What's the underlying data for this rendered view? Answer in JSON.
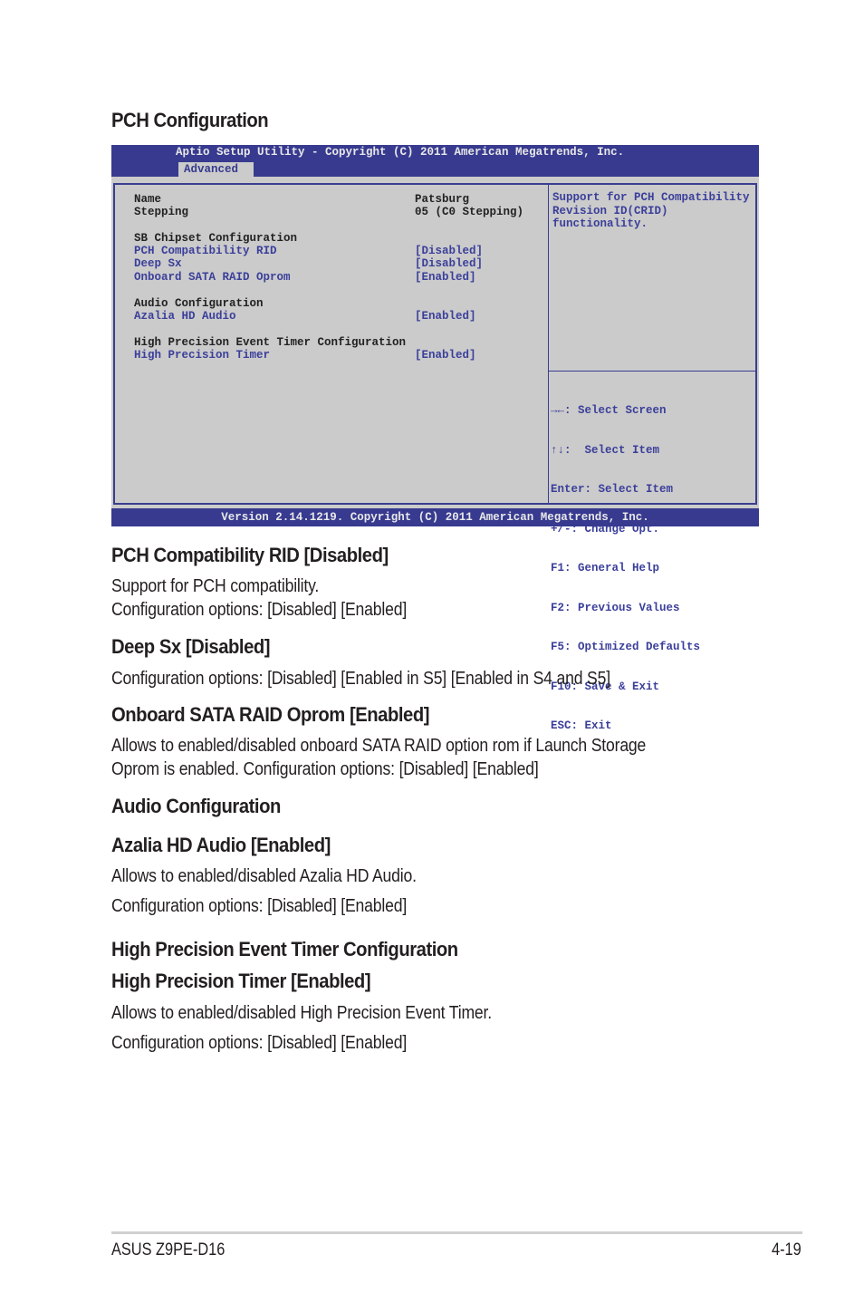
{
  "page_title": "PCH Configuration",
  "bios": {
    "title": "Aptio Setup Utility - Copyright (C) 2011 American Megatrends, Inc.",
    "active_tab": "Advanced",
    "info": [
      {
        "label": "Name",
        "value": "Patsburg"
      },
      {
        "label": "Stepping",
        "value": "05 (C0 Stepping)"
      }
    ],
    "sections": {
      "sb_chipset": "SB Chipset Configuration",
      "audio": "Audio Configuration",
      "hpet": "High Precision Event Timer Configuration"
    },
    "items": [
      {
        "label": "PCH Compatibility RID",
        "value": "[Disabled]"
      },
      {
        "label": "Deep Sx",
        "value": "[Disabled]"
      },
      {
        "label": "Onboard SATA RAID Oprom",
        "value": "[Enabled]"
      },
      {
        "label": "Azalia HD Audio",
        "value": "[Enabled]"
      },
      {
        "label": "High Precision Timer",
        "value": "[Enabled]"
      }
    ],
    "help_text": [
      "Support for PCH Compatibility",
      "Revision ID(CRID)",
      "functionality."
    ],
    "key_help": [
      "→←: Select Screen",
      "↑↓:  Select Item",
      "Enter: Select Item",
      "+/-: Change Opt.",
      "F1: General Help",
      "F2: Previous Values",
      "F5: Optimized Defaults",
      "F10: Save & Exit",
      "ESC: Exit"
    ],
    "footer": "Version 2.14.1219. Copyright (C) 2011 American Megatrends, Inc.",
    "colors": {
      "bar": "#373a8f",
      "panel": "#cbcbcb",
      "item_text": "#3b3f9a"
    }
  },
  "doc": {
    "pch_rid": {
      "heading": "PCH Compatibility RID [Disabled]",
      "lines": [
        "Support for PCH compatibility.",
        "Configuration options: [Disabled] [Enabled]"
      ]
    },
    "deep_sx": {
      "heading": "Deep Sx [Disabled]",
      "lines": [
        "Configuration options: [Disabled] [Enabled in S5] [Enabled in S4 and S5]"
      ]
    },
    "sata_oprom": {
      "heading": "Onboard SATA RAID Oprom [Enabled]",
      "lines": [
        "Allows to enabled/disabled onboard SATA RAID option rom if Launch Storage",
        "Oprom is enabled. Configuration options: [Disabled] [Enabled]"
      ]
    },
    "audio_config": {
      "heading": "Audio Configuration"
    },
    "azalia": {
      "heading": "Azalia HD Audio [Enabled]",
      "lines": [
        "Allows to enabled/disabled Azalia HD Audio.",
        "Configuration options: [Disabled] [Enabled]"
      ]
    },
    "hpet_config": {
      "heading": "High Precision Event Timer Configuration"
    },
    "hpet": {
      "heading": "High Precision Timer [Enabled]",
      "lines": [
        "Allows to enabled/disabled High Precision Event Timer.",
        "Configuration options: [Disabled] [Enabled]"
      ]
    }
  },
  "footer": {
    "product": "ASUS Z9PE-D16",
    "page": "4-19"
  }
}
